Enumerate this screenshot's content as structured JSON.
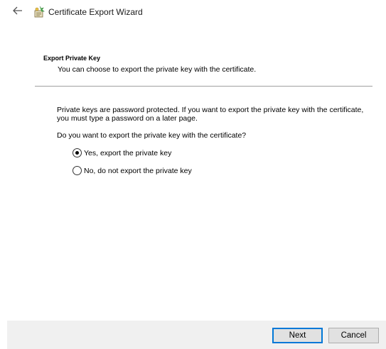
{
  "window": {
    "title": "Certificate Export Wizard",
    "back_icon": "back-arrow-icon",
    "wizard_icon": "certificate-wizard-icon"
  },
  "header": {
    "heading": "Export Private Key",
    "subtitle": "You can choose to export the private key with the certificate."
  },
  "body": {
    "info_text": "Private keys are password protected. If you want to export the private key with the certificate, you must type a password on a later page.",
    "question": "Do you want to export the private key with the certificate?",
    "options": [
      {
        "label": "Yes, export the private key",
        "selected": true
      },
      {
        "label": "No, do not export the private key",
        "selected": false
      }
    ]
  },
  "footer": {
    "next_label": "Next",
    "cancel_label": "Cancel"
  },
  "colors": {
    "accent": "#0078d7",
    "footer_bg": "#f0f0f0",
    "button_bg": "#e1e1e1"
  }
}
